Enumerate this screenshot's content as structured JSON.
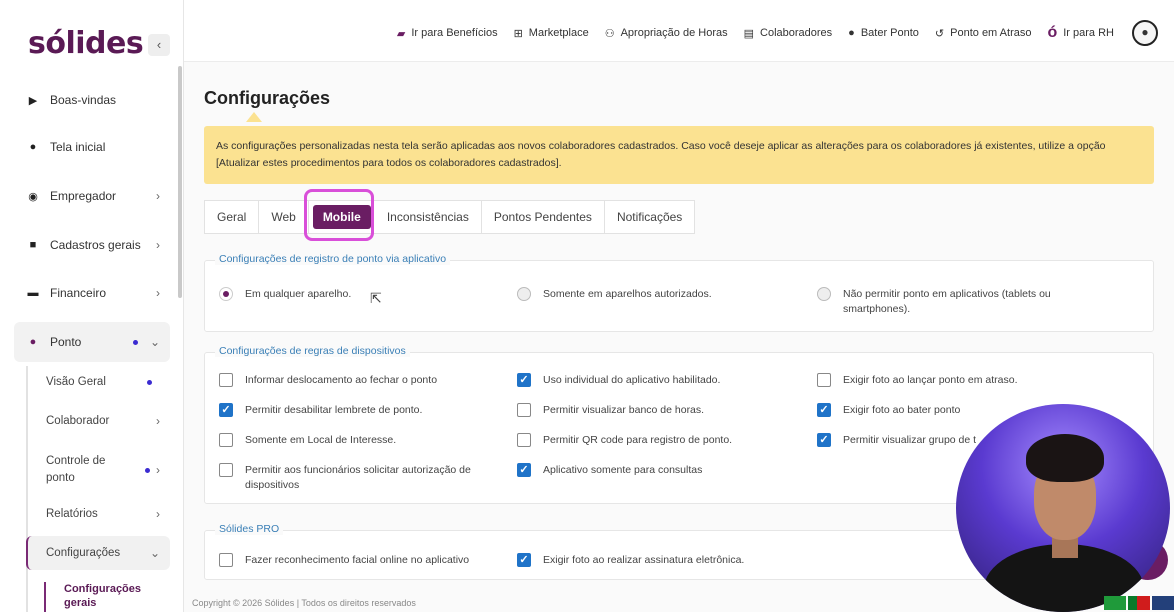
{
  "sidebar": {
    "logo": "sólides",
    "collapse_icon": "chevron-left-icon",
    "items": [
      {
        "label": "Boas-vindas",
        "icon": "play-icon"
      },
      {
        "label": "Tela inicial",
        "icon": "info-icon"
      },
      {
        "label": "Empregador",
        "icon": "user-circle-icon"
      },
      {
        "label": "Cadastros gerais",
        "icon": "list-icon"
      },
      {
        "label": "Financeiro",
        "icon": "money-icon"
      },
      {
        "label": "Ponto",
        "icon": "clock-icon"
      }
    ],
    "sub_items": [
      {
        "label": "Visão Geral"
      },
      {
        "label": "Colaborador"
      },
      {
        "label": "Controle de ponto"
      },
      {
        "label": "Relatórios"
      },
      {
        "label": "Configurações"
      }
    ],
    "sub_sub_item": "Configurações gerais"
  },
  "topbar": {
    "links": [
      {
        "label": "Ir para Benefícios",
        "icon": "gift-icon"
      },
      {
        "label": "Marketplace",
        "icon": "cart-icon"
      },
      {
        "label": "Apropriação de Horas",
        "icon": "people-icon"
      },
      {
        "label": "Colaboradores",
        "icon": "badge-icon"
      },
      {
        "label": "Bater Ponto",
        "icon": "clock-icon"
      },
      {
        "label": "Ponto em Atraso",
        "icon": "history-icon"
      },
      {
        "label": "Ir para RH",
        "icon": "solides-rh-icon"
      }
    ],
    "avatar_icon": "user-icon"
  },
  "main": {
    "title": "Configurações",
    "alert": "As configurações personalizadas nesta tela serão aplicadas aos novos colaboradores cadastrados. Caso você deseje aplicar as alterações para os colaboradores já existentes, utilize a opção [Atualizar estes procedimentos para todos os colaboradores cadastrados].",
    "tabs": [
      {
        "label": "Geral"
      },
      {
        "label": "Web"
      },
      {
        "label": "Mobile"
      },
      {
        "label": "Inconsistências"
      },
      {
        "label": "Pontos Pendentes"
      },
      {
        "label": "Notificações"
      }
    ],
    "active_tab": "Mobile",
    "group_registro": {
      "legend": "Configurações de registro de ponto via aplicativo",
      "options": [
        {
          "label": "Em qualquer aparelho.",
          "selected": true
        },
        {
          "label": "Somente em aparelhos autorizados.",
          "selected": false
        },
        {
          "label": "Não permitir ponto em aplicativos (tablets ou smartphones).",
          "selected": false
        }
      ]
    },
    "group_regras": {
      "legend": "Configurações de regras de dispositivos",
      "options": [
        {
          "label": "Informar deslocamento ao fechar o ponto",
          "checked": false
        },
        {
          "label": "Uso individual do aplicativo habilitado.",
          "checked": true
        },
        {
          "label": "Exigir foto ao lançar ponto em atraso.",
          "checked": false
        },
        {
          "label": "Permitir desabilitar lembrete de ponto.",
          "checked": true
        },
        {
          "label": "Permitir visualizar banco de horas.",
          "checked": false
        },
        {
          "label": "Exigir foto ao bater ponto",
          "checked": true
        },
        {
          "label": "Somente em Local de Interesse.",
          "checked": false
        },
        {
          "label": "Permitir QR code para registro de ponto.",
          "checked": false
        },
        {
          "label": "Permitir visualizar grupo de t",
          "checked": true
        },
        {
          "label": "Permitir aos funcionários solicitar autorização de dispositivos",
          "checked": false
        },
        {
          "label": "Aplicativo somente para consultas",
          "checked": true
        }
      ]
    },
    "group_pro": {
      "legend": "Sólides PRO",
      "options": [
        {
          "label": "Fazer reconhecimento facial online no aplicativo",
          "checked": false
        },
        {
          "label": "Exigir foto ao realizar assinatura eletrônica.",
          "checked": true
        }
      ]
    },
    "footer": "Copyright © 2026 Sólides | Todos os direitos reservados"
  },
  "colors": {
    "brand": "#6a1d63",
    "alert_bg": "#fbe291",
    "checkbox_on": "#1f73c8",
    "legend": "#3a7fb6",
    "highlight": "#d94fd9"
  }
}
